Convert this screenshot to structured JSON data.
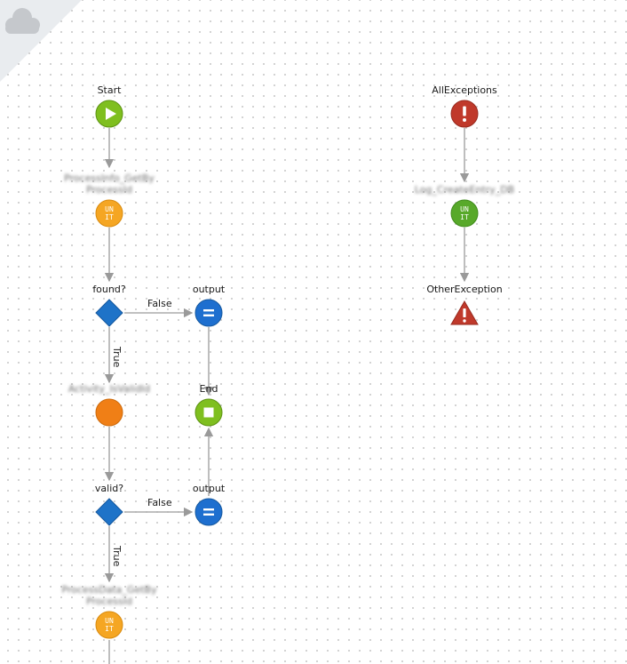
{
  "colors": {
    "start": "#7fbf1f",
    "end": "#7fbf1f",
    "unit_orange": "#f5a623",
    "unit_green": "#58a92a",
    "assign": "#1e6fcf",
    "decision": "#1e73c8",
    "exception": "#c0392b",
    "activity": "#f07f16",
    "connector": "#9a9a9a"
  },
  "flow": {
    "start_label": "Start",
    "action1_label": "ProcessInfo_GetBy ProcessId",
    "action1_icon": "UN IT",
    "decision1_label": "found?",
    "decision1_false": "False",
    "decision1_true": "True",
    "output1_label": "output",
    "end_label": "End",
    "activity_label": "Activity_IsValidId",
    "decision2_label": "valid?",
    "decision2_false": "False",
    "decision2_true": "True",
    "output2_label": "output",
    "action2_label": "ProcessData_GetBy ProcessId",
    "action2_icon": "UN IT"
  },
  "exceptions": {
    "handler_label": "AllExceptions",
    "log_label": "Log_CreateEntry_DB",
    "log_icon": "UN IT",
    "raise_label": "OtherException"
  }
}
